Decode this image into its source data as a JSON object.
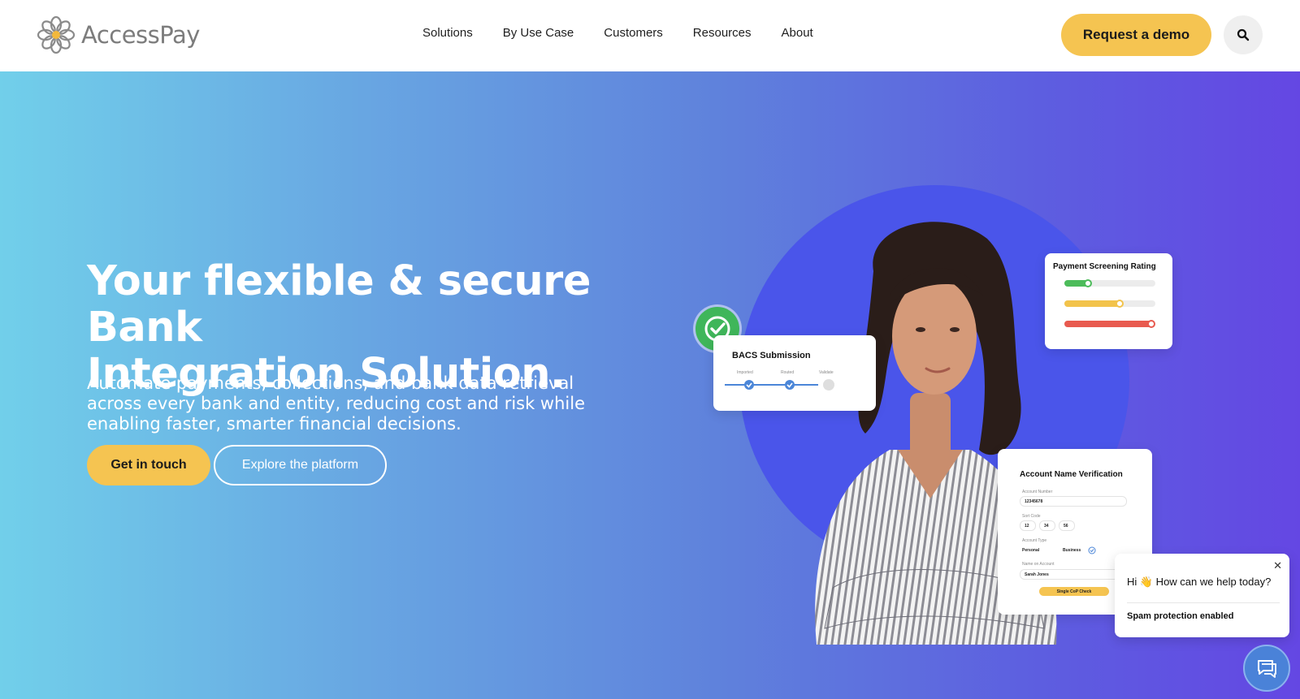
{
  "header": {
    "logo_text": "AccessPay",
    "nav": [
      "Solutions",
      "By Use Case",
      "Customers",
      "Resources",
      "About"
    ],
    "demo_label": "Request a demo"
  },
  "hero": {
    "title_line1": "Your flexible & secure Bank",
    "title_line2": "Integration Solution.",
    "subtitle": "Automate payments, collections, and bank data retrieval across every bank and entity, reducing cost and risk while enabling faster, smarter financial decisions.",
    "cta_primary": "Get in touch",
    "cta_secondary": "Explore the platform"
  },
  "cards": {
    "bacs": {
      "title": "BACS Submission",
      "steps": [
        "Imported",
        "Routed",
        "Validate"
      ]
    },
    "screening": {
      "title": "Payment Screening Rating",
      "levels": [
        {
          "color": "#4cbc5a",
          "value": 0.27
        },
        {
          "color": "#f2c34b",
          "value": 0.62
        },
        {
          "color": "#e85a4f",
          "value": 0.96
        }
      ]
    },
    "verification": {
      "title": "Account Name Verification",
      "account_number_label": "Account Number",
      "account_number": "12345678",
      "sort_code_label": "Sort Code",
      "sort_code": [
        "12",
        "34",
        "56"
      ],
      "account_type_label": "Account Type",
      "type_personal": "Personal",
      "type_business": "Business",
      "name_label": "Name on Account",
      "name_value": "Sarah Jones",
      "check_button": "Single CoP Check"
    }
  },
  "chat": {
    "greeting": "Hi 👋 How can we help today?",
    "spam": "Spam protection enabled",
    "close": "✕"
  },
  "colors": {
    "accent_yellow": "#f5c451",
    "hero_start": "#71cfea",
    "hero_end": "#6447e3",
    "circle": "#4a55ea",
    "success_green": "#3fb65a"
  }
}
